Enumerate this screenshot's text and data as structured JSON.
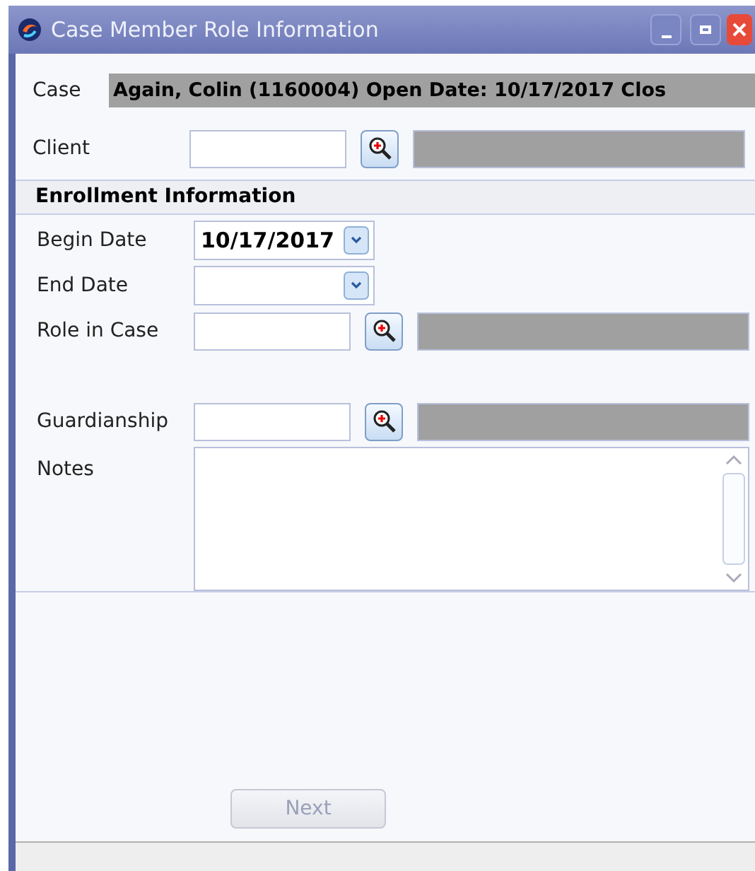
{
  "window": {
    "title": "Case Member Role Information"
  },
  "case": {
    "label": "Case",
    "value": "Again, Colin (1160004) Open Date: 10/17/2017 Clos"
  },
  "client": {
    "label": "Client",
    "kind": "lookup"
  },
  "section": {
    "title": "Enrollment Information"
  },
  "fields": [
    {
      "kind": "date",
      "label": "Begin Date",
      "value": "10/17/2017"
    },
    {
      "kind": "date",
      "label": "End Date"
    },
    {
      "kind": "lookup",
      "label": "Role in Case"
    },
    {
      "kind": "spacer"
    },
    {
      "kind": "lookup",
      "label": "Guardianship"
    },
    {
      "kind": "memo",
      "label": "Notes"
    }
  ],
  "next_button": {
    "label": "Next",
    "disabled": true
  }
}
